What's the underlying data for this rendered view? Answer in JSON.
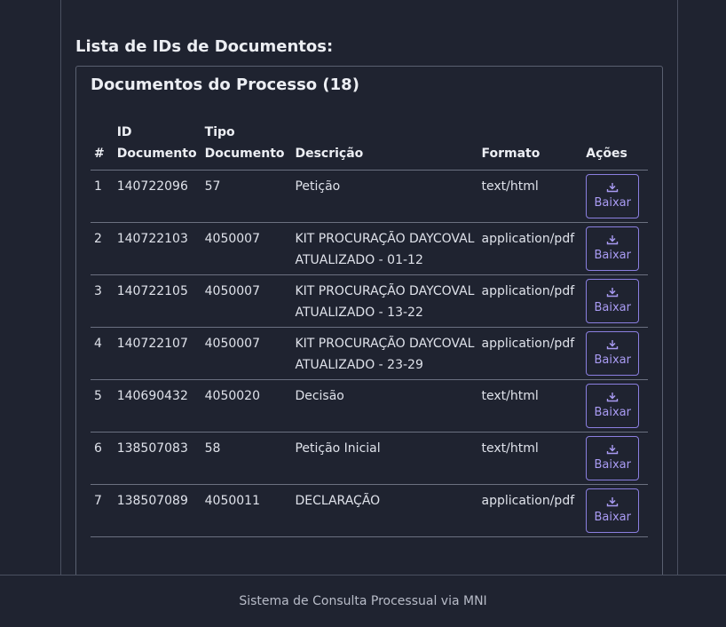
{
  "section": {
    "title": "Lista de IDs de Documentos:"
  },
  "card": {
    "title": "Documentos do Processo (18)"
  },
  "table": {
    "headers": {
      "num": "#",
      "id_line1": "ID",
      "id_line2": "Documento",
      "tipo_line1": "Tipo",
      "tipo_line2": "Documento",
      "descricao": "Descrição",
      "formato": "Formato",
      "acoes": "Ações"
    },
    "rows": [
      {
        "num": "1",
        "id": "140722096",
        "tipo": "57",
        "descricao": "Petição",
        "formato": "text/html",
        "action": "Baixar"
      },
      {
        "num": "2",
        "id": "140722103",
        "tipo": "4050007",
        "descricao": "KIT PROCURAÇÃO DAYCOVAL ATUALIZADO - 01-12",
        "formato": "application/pdf",
        "action": "Baixar"
      },
      {
        "num": "3",
        "id": "140722105",
        "tipo": "4050007",
        "descricao": "KIT PROCURAÇÃO DAYCOVAL ATUALIZADO - 13-22",
        "formato": "application/pdf",
        "action": "Baixar"
      },
      {
        "num": "4",
        "id": "140722107",
        "tipo": "4050007",
        "descricao": "KIT PROCURAÇÃO DAYCOVAL ATUALIZADO - 23-29",
        "formato": "application/pdf",
        "action": "Baixar"
      },
      {
        "num": "5",
        "id": "140690432",
        "tipo": "4050020",
        "descricao": "Decisão",
        "formato": "text/html",
        "action": "Baixar"
      },
      {
        "num": "6",
        "id": "138507083",
        "tipo": "58",
        "descricao": "Petição Inicial",
        "formato": "text/html",
        "action": "Baixar"
      },
      {
        "num": "7",
        "id": "138507089",
        "tipo": "4050011",
        "descricao": "DECLARAÇÃO",
        "formato": "application/pdf",
        "action": "Baixar"
      }
    ],
    "action_icon": "download-icon"
  },
  "footer": {
    "text": "Sistema de Consulta Processual via MNI"
  },
  "colors": {
    "background": "#1f2330",
    "accent": "#a99bf3",
    "border": "#6b7080"
  }
}
